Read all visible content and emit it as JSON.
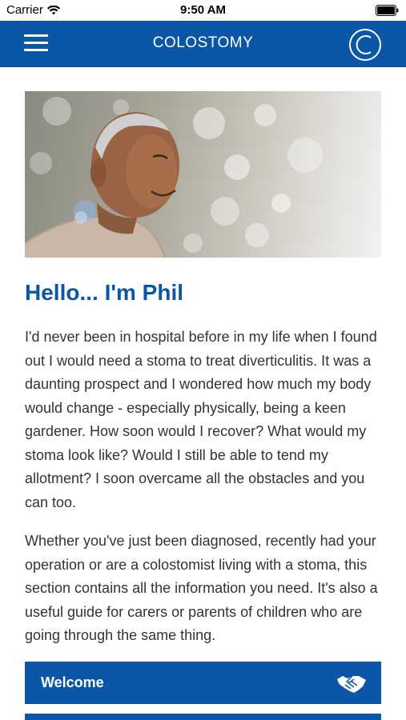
{
  "status_bar": {
    "carrier": "Carrier",
    "time": "9:50 AM"
  },
  "nav": {
    "title": "COLOSTOMY",
    "menu_icon": "hamburger-menu-icon",
    "logo_icon": "c-logo-icon"
  },
  "hero": {
    "image_description": "elderly-man-smiling-photo"
  },
  "article": {
    "headline": "Hello... I'm Phil",
    "paragraphs": [
      "I'd never been in hospital before in my life when I found out I would need a stoma to treat diverticulitis. It was a daunting prospect and I wondered how much my body would change - especially physically, being a keen gardener. How soon would I recover? What would my stoma look like? Would I still be able to tend my allotment? I soon overcame all the obstacles and you can too.",
      "Whether you've just been diagnosed, recently had your operation or are a colostomist living with a stoma, this section contains all the information you need. It's also a useful guide for carers or parents of children who are going through the same thing."
    ]
  },
  "sections": [
    {
      "label": "Welcome",
      "icon": "handshake-icon"
    }
  ],
  "colors": {
    "brand_blue": "#0b56a6",
    "body_text": "#333333",
    "background": "#ffffff"
  }
}
